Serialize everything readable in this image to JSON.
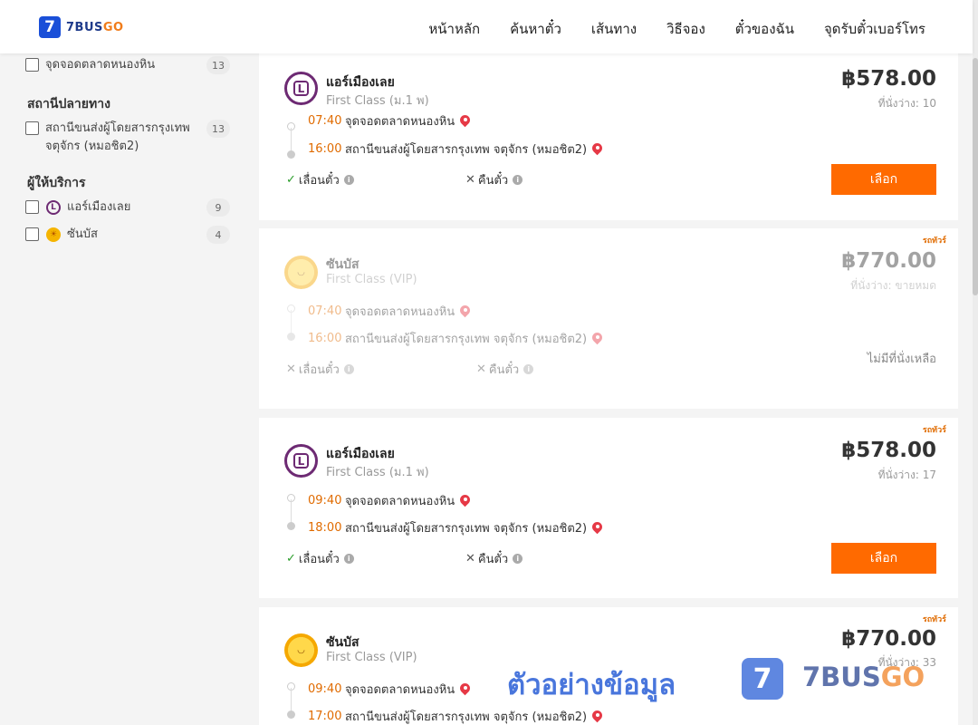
{
  "header": {
    "logo_mark": "7",
    "logo_text_a": "7BUS",
    "logo_text_b": "GO",
    "nav": [
      "หน้าหลัก",
      "ค้นหาตั๋ว",
      "เส้นทาง",
      "วิธีจอง",
      "ตั๋วของฉัน",
      "จุดรับตั๋วเบอร์โทร"
    ]
  },
  "sidebar": {
    "origin_stop": {
      "label": "จุดจอดตลาดหนองหิน",
      "count": "13"
    },
    "destination_title": "สถานีปลายทาง",
    "destination_stop": {
      "label": "สถานีขนส่งผู้โดยสารกรุงเทพ จตุจักร (หมอชิต2)",
      "count": "13"
    },
    "operator_title": "ผู้ให้บริการ",
    "operators": [
      {
        "label": "แอร์เมืองเลย",
        "count": "9",
        "icon": "air-muang-loei-logo-icon"
      },
      {
        "label": "ซันบัส",
        "count": "4",
        "icon": "sun-bus-logo-icon"
      }
    ]
  },
  "trips": [
    {
      "tag": "",
      "operator": "แอร์เมืองเลย",
      "bus_class": "First Class (ม.1 พ)",
      "price": "฿578.00",
      "seats": "ที่นั่งว่าง: 10",
      "depart_time": "07:40",
      "depart_place": "จุดจอดตลาดหนองหิน",
      "arrive_time": "16:00",
      "arrive_place": "สถานีขนส่งผู้โดยสารกรุงเทพ จตุจักร (หมอชิต2)",
      "reschedule": "เลื่อนตั๋ว",
      "refund": "คืนตั๋ว",
      "button": "เลือก"
    },
    {
      "tag": "รถทัวร์",
      "operator": "ซันบัส",
      "bus_class": "First Class (VIP)",
      "price": "฿770.00",
      "seats": "ที่นั่งว่าง: ขายหมด",
      "depart_time": "07:40",
      "depart_place": "จุดจอดตลาดหนองหิน",
      "arrive_time": "16:00",
      "arrive_place": "สถานีขนส่งผู้โดยสารกรุงเทพ จตุจักร (หมอชิต2)",
      "reschedule": "เลื่อนตั๋ว",
      "refund": "คืนตั๋ว",
      "soldout_note": "ไม่มีที่นั่งเหลือ"
    },
    {
      "tag": "รถทัวร์",
      "operator": "แอร์เมืองเลย",
      "bus_class": "First Class (ม.1 พ)",
      "price": "฿578.00",
      "seats": "ที่นั่งว่าง: 17",
      "depart_time": "09:40",
      "depart_place": "จุดจอดตลาดหนองหิน",
      "arrive_time": "18:00",
      "arrive_place": "สถานีขนส่งผู้โดยสารกรุงเทพ จตุจักร (หมอชิต2)",
      "reschedule": "เลื่อนตั๋ว",
      "refund": "คืนตั๋ว",
      "button": "เลือก"
    },
    {
      "tag": "รถทัวร์",
      "operator": "ซันบัส",
      "bus_class": "First Class (VIP)",
      "price": "฿770.00",
      "seats": "ที่นั่งว่าง: 33",
      "depart_time": "09:40",
      "depart_place": "จุดจอดตลาดหนองหิน",
      "arrive_time": "17:00",
      "arrive_place": "สถานีขนส่งผู้โดยสารกรุงเทพ จตุจักร (หมอชิต2)"
    }
  ],
  "watermark": {
    "text": "ตัวอย่างข้อมูล",
    "mark": "7",
    "brand_a": "7BUS",
    "brand_b": "GO"
  },
  "colors": {
    "accent": "#ff6a00",
    "brand_blue": "#1a4fd8",
    "time": "#e06b00",
    "pin": "#e63946"
  }
}
